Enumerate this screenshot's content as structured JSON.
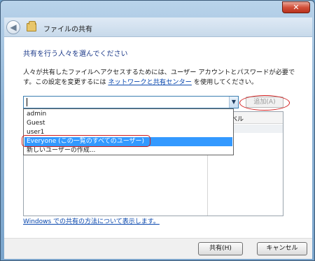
{
  "window": {
    "close_glyph": "✕",
    "back_glyph": "◀",
    "title": "ファイルの共有"
  },
  "content": {
    "heading": "共有を行う人々を選んでください",
    "desc_part1": "人々が共有したファイルへアクセスするためには、ユーザー アカウントとパスワードが必要です。この設定を変更するには ",
    "desc_link": "ネットワークと共有センター",
    "desc_part2": " を使用してください。"
  },
  "combo": {
    "value": "",
    "arrow_glyph": "▼",
    "add_button": "追加(A)"
  },
  "dropdown": {
    "items": [
      {
        "label": "admin",
        "selected": false
      },
      {
        "label": "Guest",
        "selected": false
      },
      {
        "label": "user1",
        "selected": false
      },
      {
        "label": "Everyone (この一覧のすべてのユーザー)",
        "selected": true
      },
      {
        "label": "新しいユーザーの作成...",
        "selected": false
      }
    ]
  },
  "table": {
    "column_header_partial": "可のレベル"
  },
  "help_link": "Windows での共有の方法について表示します。",
  "footer": {
    "share_button": "共有(H)",
    "cancel_button": "キャンセル"
  },
  "colors": {
    "accent_heading": "#1e3b8a",
    "link": "#0645ad",
    "selection": "#3399ff",
    "annotation_ring": "#d11b1b"
  }
}
